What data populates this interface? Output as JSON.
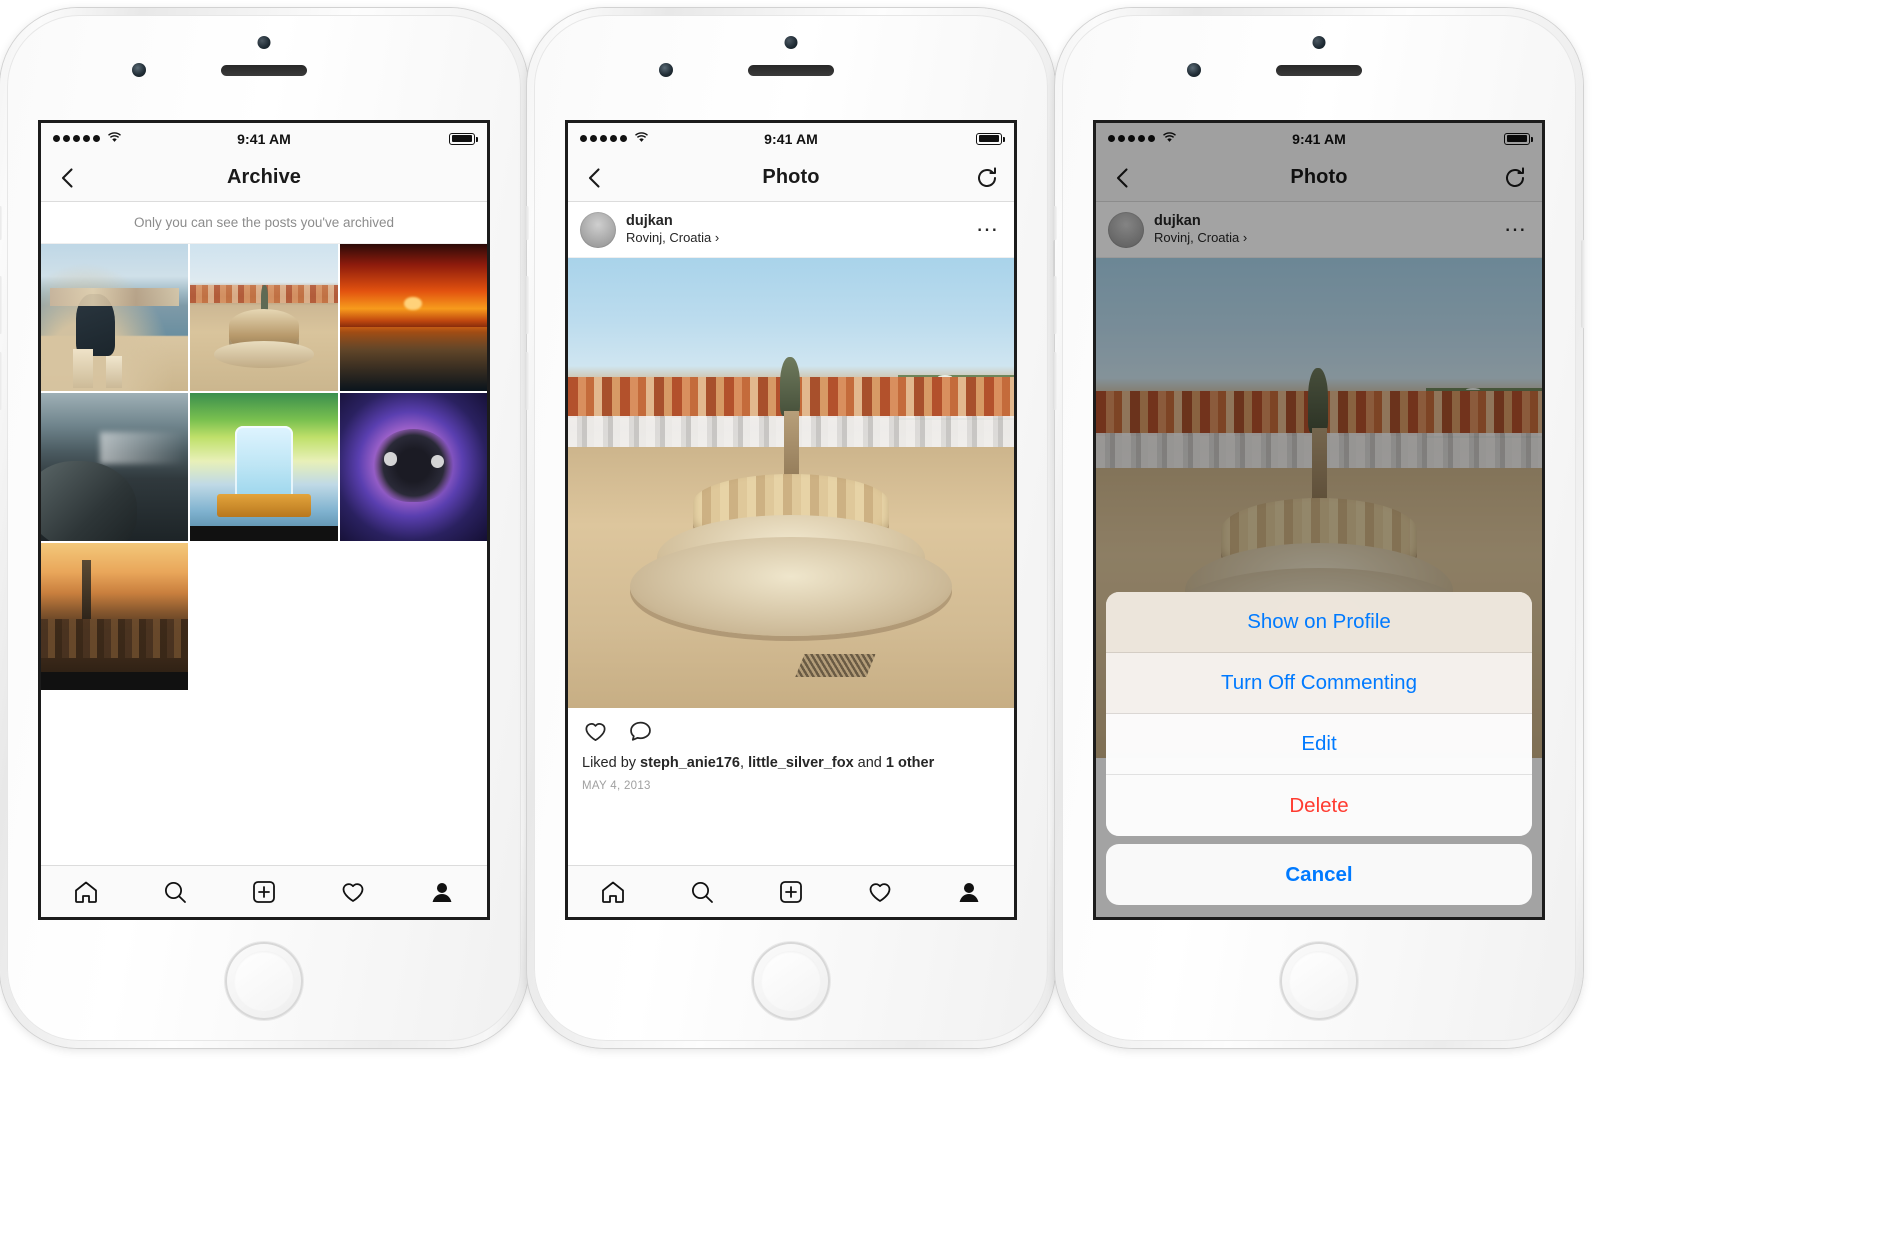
{
  "status_bar": {
    "time": "9:41 AM",
    "signal_dots": 5,
    "wifi_icon": "wifi-icon",
    "battery_icon": "battery-full-icon"
  },
  "phones": [
    {
      "id": "phone-archive",
      "navbar": {
        "back_icon": "chevron-left-icon",
        "title": "Archive",
        "right_icon": ""
      },
      "note": "Only you can see the posts you've archived",
      "grid_tiles": [
        {
          "name": "archive-tile-coast-portrait",
          "art": "art-coast"
        },
        {
          "name": "archive-tile-fountain-square",
          "art": "art-fountain-sq"
        },
        {
          "name": "archive-tile-sunset",
          "art": "art-sunset"
        },
        {
          "name": "archive-tile-rocky-sea",
          "art": "art-rocks"
        },
        {
          "name": "archive-tile-cocktail-havana-club",
          "art": "art-drink"
        },
        {
          "name": "archive-tile-butterfly",
          "art": "art-butterfly"
        },
        {
          "name": "archive-tile-harbor-sunset",
          "art": "art-harbor"
        }
      ]
    },
    {
      "id": "phone-photo",
      "navbar": {
        "back_icon": "chevron-left-icon",
        "title": "Photo",
        "right_icon": "refresh-icon"
      },
      "post": {
        "username": "dujkan",
        "location": "Rovinj, Croatia",
        "location_chevron": "chevron-right-icon",
        "more_icon": "ellipsis-icon",
        "like_icon": "heart-icon",
        "comment_icon": "comment-bubble-icon",
        "liked_by_prefix": "Liked by ",
        "liked_by_names": [
          "steph_anie176",
          "little_silver_fox"
        ],
        "liked_by_suffix_pre": " and ",
        "liked_by_count": "1 other",
        "date": "MAY 4, 2013"
      }
    },
    {
      "id": "phone-action-sheet",
      "navbar": {
        "back_icon": "chevron-left-icon",
        "title": "Photo",
        "right_icon": "refresh-icon"
      },
      "post": {
        "username": "dujkan",
        "location": "Rovinj, Croatia",
        "location_chevron": "chevron-right-icon",
        "more_icon": "ellipsis-icon"
      },
      "action_sheet": {
        "items": [
          {
            "label": "Show on Profile",
            "style": "default"
          },
          {
            "label": "Turn Off Commenting",
            "style": "default"
          },
          {
            "label": "Edit",
            "style": "default"
          },
          {
            "label": "Delete",
            "style": "destructive"
          }
        ],
        "cancel_label": "Cancel"
      }
    }
  ],
  "tabbar": {
    "items": [
      {
        "name": "tab-home",
        "icon": "home-icon"
      },
      {
        "name": "tab-search",
        "icon": "search-icon"
      },
      {
        "name": "tab-add-post",
        "icon": "plus-square-icon"
      },
      {
        "name": "tab-activity",
        "icon": "heart-icon"
      },
      {
        "name": "tab-profile",
        "icon": "person-icon"
      }
    ]
  },
  "colors": {
    "ios_blue": "#007aff",
    "ios_red": "#ff3b30",
    "text_primary": "#262626",
    "text_muted": "#8c8c8c",
    "chrome_bg": "#fafafa"
  }
}
